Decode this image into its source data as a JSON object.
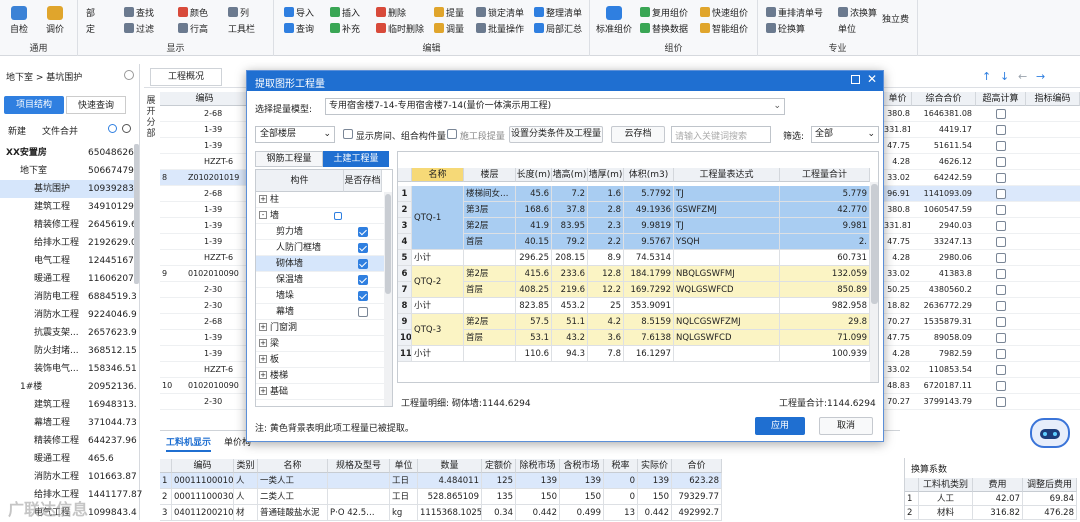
{
  "ribbon": {
    "groups": [
      {
        "label": "通用",
        "buttons": [
          "自检",
          "调价"
        ]
      },
      {
        "label": "显示",
        "buttons": [
          "部",
          "定",
          "查找",
          "过滤",
          "颜色",
          "行高",
          "列",
          "工具栏"
        ]
      },
      {
        "label": "编辑",
        "buttons": [
          "导入",
          "查询",
          "插入",
          "补充",
          "删除",
          "临时删除",
          "提量",
          "调量",
          "锁定清单",
          "批量操作",
          "整理清单",
          "局部汇总"
        ]
      },
      {
        "label": "组价",
        "buttons": [
          "标准组价",
          "复用组价",
          "替换数据",
          "快速组价",
          "智能组价"
        ]
      },
      {
        "label": "专业",
        "buttons": [
          "重排清单号",
          "砼换算",
          "浓换算",
          "单位",
          "独立费"
        ]
      }
    ]
  },
  "nav": {
    "breadcrumb": "地下室 > 基坑围护",
    "tabs": [
      "项目结构",
      "快速查询"
    ],
    "toolbar": [
      "新建",
      "文件合并"
    ],
    "tab_overview": "工程概况"
  },
  "tree": [
    {
      "label": "XX安置房",
      "value": "65048626.",
      "level": 0,
      "bold": true
    },
    {
      "label": "地下室",
      "value": "506674795",
      "level": 1
    },
    {
      "label": "基坑围护",
      "value": "109392830",
      "level": 2,
      "selected": true
    },
    {
      "label": "建筑工程",
      "value": "349101291",
      "level": 2
    },
    {
      "label": "精装修工程",
      "value": "2645619.6",
      "level": 2
    },
    {
      "label": "给排水工程",
      "value": "2192629.0",
      "level": 2
    },
    {
      "label": "电气工程",
      "value": "12445167.",
      "level": 2
    },
    {
      "label": "暖通工程",
      "value": "11606207.",
      "level": 2
    },
    {
      "label": "消防电工程",
      "value": "6884519.3",
      "level": 2
    },
    {
      "label": "消防水工程",
      "value": "9224046.9",
      "level": 2
    },
    {
      "label": "抗震支架...",
      "value": "2657623.9",
      "level": 2
    },
    {
      "label": "防火封堵...",
      "value": "368512.15",
      "level": 2
    },
    {
      "label": "装饰电气...",
      "value": "158346.51",
      "level": 2
    },
    {
      "label": "1#楼",
      "value": "20952136.",
      "level": 1
    },
    {
      "label": "建筑工程",
      "value": "16948313.",
      "level": 2
    },
    {
      "label": "幕墙工程",
      "value": "371044.73",
      "level": 2
    },
    {
      "label": "精装修工程",
      "value": "644237.96",
      "level": 2
    },
    {
      "label": "暖通工程",
      "value": "465.6",
      "level": 2
    },
    {
      "label": "消防水工程",
      "value": "101663.87",
      "level": 2
    },
    {
      "label": "给排水工程",
      "value": "1441177.87",
      "level": 2
    },
    {
      "label": "电气工程",
      "value": "1099843.4",
      "level": 2
    }
  ],
  "bg_grid": {
    "header_code": "编码",
    "side_label": "展开分部",
    "rows": [
      {
        "no": "",
        "code": "2-68"
      },
      {
        "no": "",
        "code": "1-39"
      },
      {
        "no": "",
        "code": "1-39"
      },
      {
        "no": "",
        "code": "HZZT-6"
      },
      {
        "no": "8",
        "code": "Z010201019"
      },
      {
        "no": "",
        "code": "2-68"
      },
      {
        "no": "",
        "code": "1-39"
      },
      {
        "no": "",
        "code": "1-39"
      },
      {
        "no": "",
        "code": "1-39"
      },
      {
        "no": "",
        "code": "HZZT-6"
      },
      {
        "no": "9",
        "code": "0102010090"
      },
      {
        "no": "",
        "code": "2-30"
      },
      {
        "no": "",
        "code": "2-30"
      },
      {
        "no": "",
        "code": "2-68"
      },
      {
        "no": "",
        "code": "1-39"
      },
      {
        "no": "",
        "code": "1-39"
      },
      {
        "no": "",
        "code": "HZZT-6"
      },
      {
        "no": "10",
        "code": "0102010090"
      },
      {
        "no": "",
        "code": "2-30"
      }
    ]
  },
  "right_grid": {
    "headers": [
      "单价",
      "综合合价",
      "超高计算",
      "指标编码"
    ],
    "rows": [
      [
        "380.8",
        "1646381.08"
      ],
      [
        "331.81",
        "4419.17"
      ],
      [
        "47.75",
        "51611.54"
      ],
      [
        "4.28",
        "4626.12"
      ],
      [
        "33.02",
        "64242.59"
      ],
      [
        "96.91",
        "1141093.09"
      ],
      [
        "380.8",
        "1060547.59"
      ],
      [
        "331.81",
        "2940.03"
      ],
      [
        "47.75",
        "33247.13"
      ],
      [
        "4.28",
        "2980.06"
      ],
      [
        "33.02",
        "41383.8"
      ],
      [
        "50.25",
        "4380560.2"
      ],
      [
        "18.82",
        "2636772.29"
      ],
      [
        "70.27",
        "1535879.31"
      ],
      [
        "47.75",
        "89058.09"
      ],
      [
        "4.28",
        "7982.59"
      ],
      [
        "33.02",
        "110853.54"
      ],
      [
        "48.83",
        "6720187.11"
      ],
      [
        "70.27",
        "3799143.79"
      ]
    ]
  },
  "top_icons": [
    "arrow-up",
    "arrow-down",
    "arrow-left",
    "arrow-right"
  ],
  "dialog": {
    "title": "提取图形工程量",
    "model_label": "选择提量模型:",
    "model_value": "专用宿舍楼7-14-专用宿舍楼7-14(量价一体演示用工程)",
    "floor_select": "全部楼层",
    "chk_show_room": "显示房间、组合构件量",
    "chk_construction": "施工段提量",
    "btn_settings": "设置分类条件及工程量",
    "btn_cloud": "云存档",
    "search_placeholder": "请输入关键词搜索",
    "filter_label": "筛选:",
    "filter_value": "全部",
    "tabs": [
      "钢筋工程量",
      "土建工程量"
    ],
    "tree_headers": [
      "构件",
      "是否存档"
    ],
    "tree": [
      {
        "label": "柱",
        "level": 0,
        "exp": "+"
      },
      {
        "label": "墙",
        "level": 0,
        "exp": "-"
      },
      {
        "label": "剪力墙",
        "level": 1,
        "checked": true
      },
      {
        "label": "人防门框墙",
        "level": 1,
        "checked": true
      },
      {
        "label": "砌体墙",
        "level": 1,
        "checked": true,
        "selected": true
      },
      {
        "label": "保温墙",
        "level": 1,
        "checked": true
      },
      {
        "label": "墙垛",
        "level": 1,
        "checked": true
      },
      {
        "label": "幕墙",
        "level": 1,
        "checked": false
      },
      {
        "label": "门窗洞",
        "level": 0,
        "exp": "+"
      },
      {
        "label": "梁",
        "level": 0,
        "exp": "+"
      },
      {
        "label": "板",
        "level": 0,
        "exp": "+"
      },
      {
        "label": "楼梯",
        "level": 0,
        "exp": "+"
      },
      {
        "label": "基础",
        "level": 0,
        "exp": "+"
      }
    ],
    "grid_headers": [
      "名称",
      "楼层",
      "长度(m)",
      "墙高(m)",
      "墙厚(m)",
      "体积(m3)",
      "工程量表达式",
      "工程量合计"
    ],
    "grid_rows": [
      {
        "no": "1",
        "name": "QTQ-1",
        "floor": "楼梯间女…",
        "len": "45.6",
        "h": "7.2",
        "t": "1.6",
        "v": "5.7792",
        "expr": "TJ",
        "sum": "5.779",
        "group": "blue"
      },
      {
        "no": "2",
        "name": "",
        "floor": "第3层",
        "len": "168.6",
        "h": "37.8",
        "t": "2.8",
        "v": "49.1936",
        "expr": "GSWFZMJ",
        "sum": "42.770",
        "group": "blue"
      },
      {
        "no": "3",
        "name": "",
        "floor": "第2层",
        "len": "41.9",
        "h": "83.95",
        "t": "2.3",
        "v": "9.9819",
        "expr": "TJ",
        "sum": "9.981",
        "group": "blue"
      },
      {
        "no": "4",
        "name": "",
        "floor": "首层",
        "len": "40.15",
        "h": "79.2",
        "t": "2.2",
        "v": "9.5767",
        "expr": "YSQH",
        "sum": "2.",
        "group": "blue"
      },
      {
        "no": "5",
        "name": "小计",
        "floor": "",
        "len": "296.25",
        "h": "208.15",
        "t": "8.9",
        "v": "74.5314",
        "expr": "",
        "sum": "60.731",
        "group": "white"
      },
      {
        "no": "6",
        "name": "QTQ-2",
        "floor": "第2层",
        "len": "415.6",
        "h": "233.6",
        "t": "12.8",
        "v": "184.1799",
        "expr": "NBQLGSWFMJ",
        "sum": "132.059",
        "group": "yellow"
      },
      {
        "no": "7",
        "name": "",
        "floor": "首层",
        "len": "408.25",
        "h": "219.6",
        "t": "12.2",
        "v": "169.7292",
        "expr": "WQLGSWFCD",
        "sum": "850.89",
        "group": "yellow"
      },
      {
        "no": "8",
        "name": "小计",
        "floor": "",
        "len": "823.85",
        "h": "453.2",
        "t": "25",
        "v": "353.9091",
        "expr": "",
        "sum": "982.958",
        "group": "white"
      },
      {
        "no": "9",
        "name": "QTQ-3",
        "floor": "第2层",
        "len": "57.5",
        "h": "51.1",
        "t": "4.2",
        "v": "8.5159",
        "expr": "NQLCGSWFZMJ",
        "sum": "29.8",
        "group": "yellow"
      },
      {
        "no": "10",
        "name": "",
        "floor": "首层",
        "len": "53.1",
        "h": "43.2",
        "t": "3.6",
        "v": "7.6138",
        "expr": "NQLGSWFCD",
        "sum": "71.099",
        "group": "yellow"
      },
      {
        "no": "11",
        "name": "小计",
        "floor": "",
        "len": "110.6",
        "h": "94.3",
        "t": "7.8",
        "v": "16.1297",
        "expr": "",
        "sum": "100.939",
        "group": "white"
      }
    ],
    "detail_label": "工程量明细:",
    "detail_value": "砌体墙:1144.6294",
    "total_label": "工程量合计:",
    "total_value": "1144.6294",
    "note": "注: 黄色背景表明此项工程量已被提取。",
    "btn_apply": "应用",
    "btn_cancel": "取消"
  },
  "bottom": {
    "tabs": [
      "工料机显示",
      "单价构"
    ],
    "headers": [
      "编码",
      "类别",
      "名称",
      "规格及型号",
      "单位",
      "数量",
      "定额价",
      "除税市场价",
      "含税市场价",
      "税率(%)",
      "实际价",
      "合价"
    ],
    "rows": [
      [
        "000111000101",
        "人",
        "一类人工",
        "",
        "工日",
        "4.484011",
        "125",
        "139",
        "139",
        "0",
        "139",
        "623.28"
      ],
      [
        "000111000301",
        "人",
        "二类人工",
        "",
        "工日",
        "528.865109",
        "135",
        "150",
        "150",
        "0",
        "150",
        "79329.77"
      ],
      [
        "040112002101",
        "材",
        "普通硅酸盐水泥",
        "P·O 42.5…",
        "kg",
        "1115368.10256",
        "0.34",
        "0.442",
        "0.499",
        "13",
        "0.442",
        "492992.7"
      ]
    ],
    "right_title": "换算系数",
    "right_headers": [
      "工料机类别",
      "费用",
      "调整后费用"
    ],
    "right_rows": [
      [
        "1",
        "人工",
        "42.07",
        "69.84"
      ],
      [
        "2",
        "材料",
        "316.82",
        "476.28"
      ]
    ]
  },
  "watermark": "广联达信息"
}
